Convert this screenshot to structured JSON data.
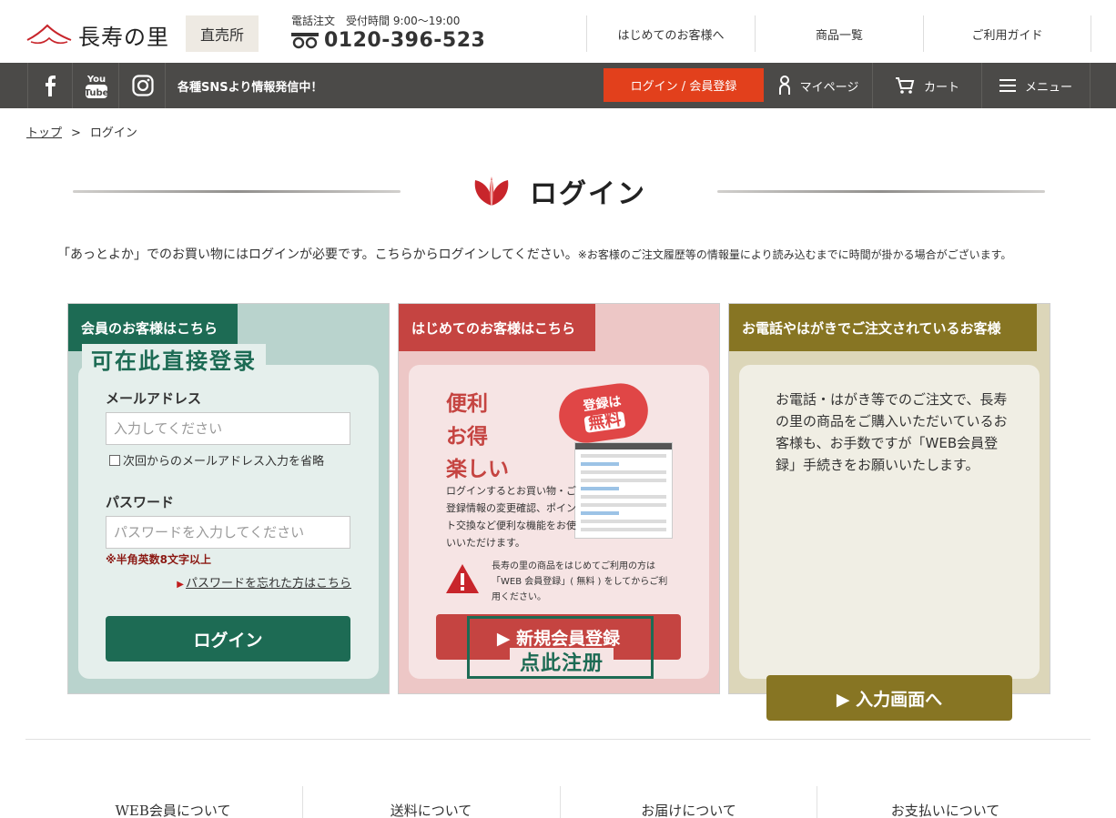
{
  "header": {
    "logo_text": "長寿の里",
    "store_badge": "直売所",
    "phone_label": "電話注文　受付時間 9:00〜19:00",
    "phone_number": "0120-396-523",
    "nav": [
      "はじめてのお客様へ",
      "商品一覧",
      "ご利用ガイド"
    ]
  },
  "darkbar": {
    "sns_icons": [
      "facebook-icon",
      "youtube-icon",
      "instagram-icon"
    ],
    "sns_text": "各種SNSより情報発信中！",
    "login_register": "ログイン / 会員登録",
    "mypage": "マイページ",
    "cart": "カート",
    "menu": "メニュー"
  },
  "breadcrumb": {
    "top": "トップ",
    "separator": ">",
    "current": "ログイン"
  },
  "page_title": "ログイン",
  "intro": {
    "main": "「あっとよか」でのお買い物にはログインが必要です。こちらからログインしてください。",
    "note": "※お客様のご注文履歴等の情報量により読み込むまでに時間が掛かる場合がございます。"
  },
  "member_panel": {
    "tab": "会員のお客様はこちら",
    "overlay_label": "可在此直接登录",
    "email_label": "メールアドレス",
    "email_placeholder": "入力してください",
    "remember_label": "次回からのメールアドレス入力を省略",
    "password_label": "パスワード",
    "password_placeholder": "パスワードを入力してください",
    "password_note": "※半角英数8文字以上",
    "forgot_link": "パスワードを忘れた方はこちら",
    "login_button": "ログイン"
  },
  "new_panel": {
    "tab": "はじめてのお客様はこちら",
    "benefits": [
      "便利",
      "お得",
      "楽しい"
    ],
    "badge_top": "登録は",
    "badge_free": "無料",
    "description": "ログインするとお買い物・ご登録情報の変更確認、ポイント交換など便利な機能をお使いいただけます。",
    "warning": "長寿の里の商品をはじめてご利用の方は「WEB 会員登録」( 無料 ) をしてからご利用ください。",
    "register_button": "▶ 新規会員登録",
    "overlay_label": "点此注册"
  },
  "phone_panel": {
    "tab": "お電話やはがきでご注文されているお客様",
    "description": "お電話・はがき等でのご注文で、長寿の里の商品をご購入いただいているお客様も、お手数ですが「WEB会員登録」手続きをお願いいたします。",
    "input_button": "▶ 入力画面へ"
  },
  "footer": {
    "nav": [
      "WEB会員について",
      "送料について",
      "お届けについて",
      "お支払いについて"
    ]
  },
  "colors": {
    "brand_orange": "#e2401c",
    "member_green": "#1d6b54",
    "new_red": "#c54441",
    "phone_olive": "#877523",
    "dark_bar": "#4b4a48"
  }
}
